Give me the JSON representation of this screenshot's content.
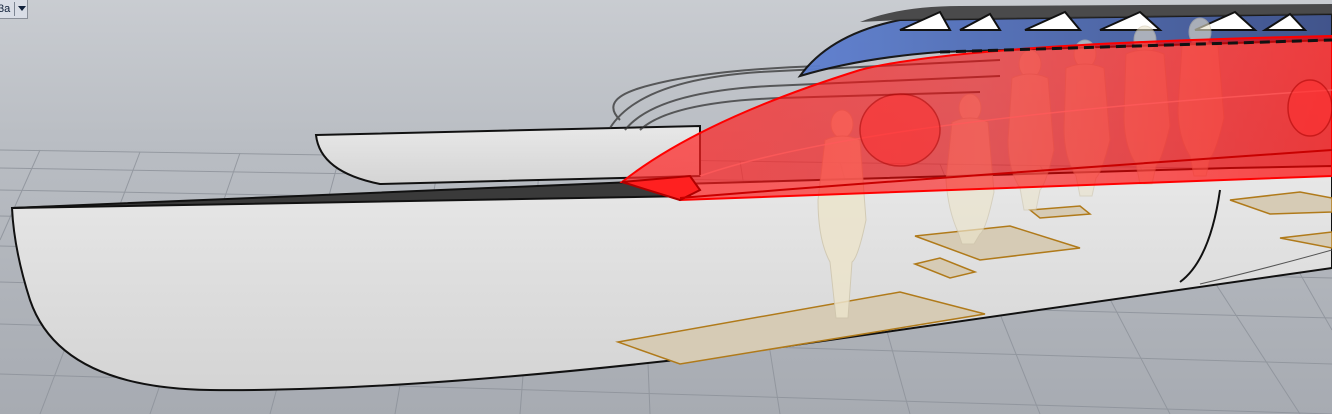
{
  "viewport": {
    "name_label": "3a",
    "dropdown_icon": "chevron-down-icon"
  },
  "colors": {
    "background_top": "#c9ccd1",
    "background_bottom": "#a7abb2",
    "grid_line": "#8e939b",
    "hull_fill": "#dedede",
    "hull_outline": "#111111",
    "deck_dark": "#3a3a3a",
    "cabin_glass": "#5a78c4",
    "selection_red": "#ff1a1a",
    "mannequin": "#e8e0c8",
    "floor_pad": "#d6cbb5",
    "floor_pad_edge": "#b07a1a"
  }
}
